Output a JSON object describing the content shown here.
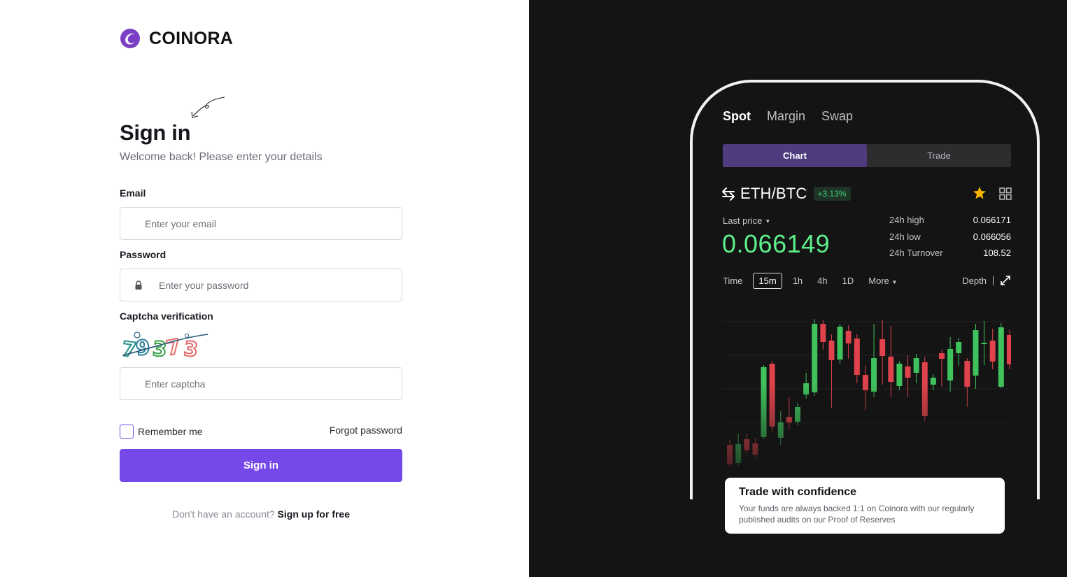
{
  "brand": {
    "name": "COINORA"
  },
  "signin": {
    "title": "Sign in",
    "subtitle": "Welcome back! Please enter your details",
    "email_label": "Email",
    "email_placeholder": "Enter your email",
    "password_label": "Password",
    "password_placeholder": "Enter your password",
    "captcha_label": "Captcha verification",
    "captcha_code": "79373",
    "captcha_placeholder": "Enter captcha",
    "remember_label": "Remember me",
    "remember_checked": false,
    "forgot_label": "Forgot password",
    "submit_label": "Sign in",
    "no_account_text": "Don't have an account?",
    "signup_link": "Sign up for free"
  },
  "preview": {
    "tabs": [
      {
        "label": "Spot",
        "active": true
      },
      {
        "label": "Margin",
        "active": false
      },
      {
        "label": "Swap",
        "active": false
      }
    ],
    "segments": [
      {
        "label": "Chart",
        "active": true
      },
      {
        "label": "Trade",
        "active": false
      }
    ],
    "pair": "ETH/BTC",
    "change_pct": "+3.13%",
    "last_price_label": "Last price",
    "last_price": "0.066149",
    "stats": [
      {
        "label": "24h high",
        "value": "0.066171"
      },
      {
        "label": "24h low",
        "value": "0.066056"
      },
      {
        "label": "24h Turnover",
        "value": "108.52"
      }
    ],
    "toolbar": {
      "time_label": "Time",
      "intervals": [
        "15m",
        "1h",
        "4h",
        "1D"
      ],
      "selected_interval": "15m",
      "more_label": "More",
      "depth_label": "Depth"
    },
    "colors": {
      "up": "#3fc25c",
      "down": "#e0434c",
      "accent": "#7548ea",
      "price": "#5ef08a"
    },
    "confidence": {
      "title": "Trade with confidence",
      "text": "Your funds are always backed 1:1 on Coinora with our regularly published audits on our Proof of Reserves"
    }
  },
  "chart_data": {
    "type": "candlestick",
    "candles": [
      {
        "o": 32,
        "c": 4,
        "h": 40,
        "l": 0
      },
      {
        "o": 6,
        "c": 33,
        "h": 48,
        "l": 2
      },
      {
        "o": 40,
        "c": 24,
        "h": 48,
        "l": 18
      },
      {
        "o": 34,
        "c": 18,
        "h": 42,
        "l": 12
      },
      {
        "o": 43,
        "c": 143,
        "h": 146,
        "l": 40
      },
      {
        "o": 148,
        "c": 58,
        "h": 152,
        "l": 50
      },
      {
        "o": 42,
        "c": 64,
        "h": 80,
        "l": 32
      },
      {
        "o": 72,
        "c": 64,
        "h": 100,
        "l": 54
      },
      {
        "o": 65,
        "c": 86,
        "h": 92,
        "l": 60
      },
      {
        "o": 104,
        "c": 120,
        "h": 135,
        "l": 98
      },
      {
        "o": 107,
        "c": 205,
        "h": 212,
        "l": 102
      },
      {
        "o": 205,
        "c": 179,
        "h": 210,
        "l": 168
      },
      {
        "o": 181,
        "c": 153,
        "h": 190,
        "l": 85
      },
      {
        "o": 154,
        "c": 201,
        "h": 205,
        "l": 148
      },
      {
        "o": 195,
        "c": 177,
        "h": 203,
        "l": 155
      },
      {
        "o": 184,
        "c": 132,
        "h": 190,
        "l": 120
      },
      {
        "o": 132,
        "c": 110,
        "h": 145,
        "l": 82
      },
      {
        "o": 108,
        "c": 156,
        "h": 205,
        "l": 100
      },
      {
        "o": 183,
        "c": 159,
        "h": 210,
        "l": 118
      },
      {
        "o": 158,
        "c": 122,
        "h": 202,
        "l": 100
      },
      {
        "o": 116,
        "c": 148,
        "h": 152,
        "l": 110
      },
      {
        "o": 144,
        "c": 128,
        "h": 160,
        "l": 100
      },
      {
        "o": 135,
        "c": 156,
        "h": 162,
        "l": 120
      },
      {
        "o": 150,
        "c": 73,
        "h": 158,
        "l": 66
      },
      {
        "o": 118,
        "c": 128,
        "h": 133,
        "l": 110
      },
      {
        "o": 163,
        "c": 155,
        "h": 168,
        "l": 115
      },
      {
        "o": 124,
        "c": 169,
        "h": 186,
        "l": 108
      },
      {
        "o": 163,
        "c": 179,
        "h": 185,
        "l": 145
      },
      {
        "o": 152,
        "c": 115,
        "h": 156,
        "l": 86
      },
      {
        "o": 131,
        "c": 196,
        "h": 205,
        "l": 112
      },
      {
        "o": 178,
        "c": 178,
        "h": 209,
        "l": 146
      },
      {
        "o": 181,
        "c": 151,
        "h": 198,
        "l": 140
      },
      {
        "o": 115,
        "c": 200,
        "h": 206,
        "l": 113
      },
      {
        "o": 189,
        "c": 147,
        "h": 196,
        "l": 140
      }
    ]
  }
}
